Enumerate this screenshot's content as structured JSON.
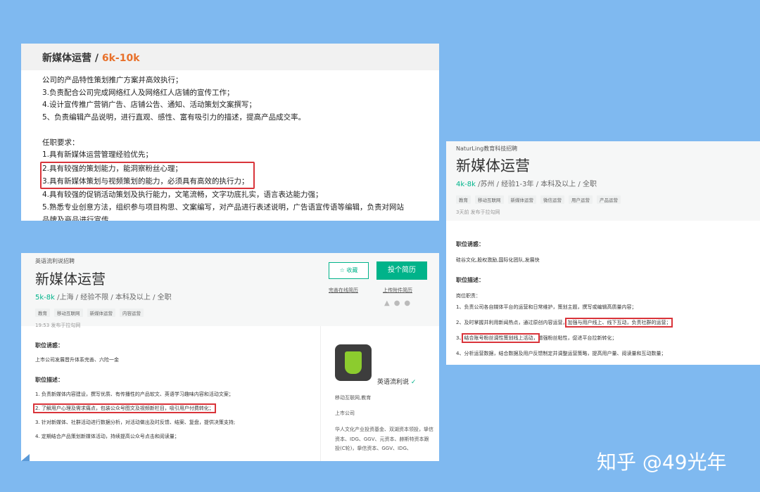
{
  "panel1": {
    "title": "新媒体运营 / ",
    "salary": "6k-10k",
    "lines": [
      "公司的产品特性策划推广方案并高效执行；",
      "3.负责配合公司完成网络红人及网络红人店铺的宣传工作；",
      "4.设计宣传推广营销广告、店铺公告、通知、活动策划文案撰写；",
      "5、负责编辑产品说明，进行直观、感性、富有吸引力的描述，提高产品成交率。"
    ],
    "req_title": "任职要求：",
    "req1": "1.具有新媒体运营管理经验优先；",
    "req2": "2.具有较强的策划能力，能洞察粉丝心理；",
    "req3": "3.具有新媒体策划与视频策划的能力，必须具有高效的执行力；",
    "req4": "4.具有较强的促销活动策划及执行能力，文笔流畅，文字功底扎实，语言表达能力强；",
    "req5": "5.熟悉专业创意方法，组织参与项目构思、文案编写，对产品进行表述说明，广告语宣传语等编辑，负责对网站",
    "req5b": "品牌及商品进行宣传。"
  },
  "panel2": {
    "company": "英语流利说招聘",
    "title": "新媒体运营",
    "salary": "5k-8k",
    "meta": " /上海 / 经验不限 / 本科及以上 / 全职",
    "tags": [
      "教育",
      "移动互联网",
      "新媒体运营",
      "内容运营"
    ],
    "time": "19:53  发布于拉勾网",
    "fav_label": "☆ 收藏",
    "apply_label": "投个简历",
    "link1": "完善在线简历",
    "link2": "上传附件简历",
    "lure_title": "职位诱惑：",
    "lure": "上市公司发展晋升体系完善、六险一金",
    "desc_title": "职位描述：",
    "d1": "1. 负责新媒体内容建设，撰写优质、有传播性的产品软文、英语学习趣味内容和活动文案；",
    "d2": "2. 了解用户心理及需求痛点，包装公众号图文及视频新栏目，吸引用户付费转化；",
    "d3": "3. 针对新媒体、社群活动进行数据分析，对活动做出及时反馈、结案、复盘，提供决策支持;",
    "d4": "4. 定期结合产品策划新媒体活动，持续提高公众号点击和阅读量；",
    "company_name": "英语流利说",
    "side1": "移动互联网,教育",
    "side2": "上市公司",
    "side3": "华人文化产业投资基金、双湖资本领投，挚信资本、IDG、GGV、元资本、赫斯特资本跟投(C轮)，挚信资本、GGV、IDG、"
  },
  "panel3": {
    "company": "NaturLing教育科技招聘",
    "title": "新媒体运营",
    "salary": "4k-8k",
    "meta": " /苏州 / 经验1-3年 / 本科及以上 / 全职",
    "tags": [
      "教育",
      "移动互联网",
      "新媒体运营",
      "微信运营",
      "用户运营",
      "产品运营"
    ],
    "time": "3天前  发布于拉勾网",
    "lure_title": "职位诱惑：",
    "lure": "硅谷文化,股权激励,国际化团队,发展快",
    "desc_title": "职位描述：",
    "duty": "岗位职责：",
    "d1": "1、负责公司各自媒体平台的运营和日常维护，策划主题，撰写或编辑高质量内容；",
    "d2a": "2、及时掌握并利用新闻热点，通过原创内容运营，",
    "d2b": "加强与用户线上、线下互动，负责社群的运营；",
    "d3a": "3、",
    "d3b": "结合账号粉丝调性策划线上活动，",
    "d3c": "增强粉丝粘性，促进平台拉新转化；",
    "d4": "4、分析运营数据，结合数据及用户反馈制定并调整运营策略，提高用户量、阅读量和互动数量；"
  },
  "watermark": "知乎 @49光年"
}
